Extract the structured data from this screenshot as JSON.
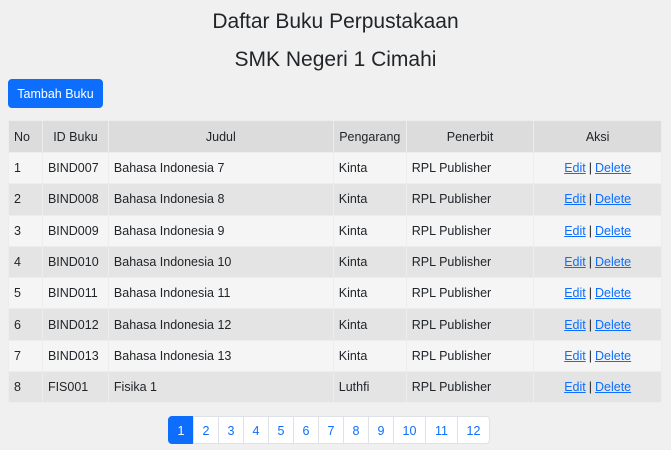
{
  "header": {
    "title": "Daftar Buku Perpustakaan",
    "subtitle": "SMK Negeri 1 Cimahi"
  },
  "toolbar": {
    "add_label": "Tambah Buku"
  },
  "table": {
    "columns": [
      "No",
      "ID Buku",
      "Judul",
      "Pengarang",
      "Penerbit",
      "Aksi"
    ],
    "rows": [
      {
        "no": "1",
        "id": "BIND007",
        "judul": "Bahasa Indonesia 7",
        "pengarang": "Kinta",
        "penerbit": "RPL Publisher"
      },
      {
        "no": "2",
        "id": "BIND008",
        "judul": "Bahasa Indonesia 8",
        "pengarang": "Kinta",
        "penerbit": "RPL Publisher"
      },
      {
        "no": "3",
        "id": "BIND009",
        "judul": "Bahasa Indonesia 9",
        "pengarang": "Kinta",
        "penerbit": "RPL Publisher"
      },
      {
        "no": "4",
        "id": "BIND010",
        "judul": "Bahasa Indonesia 10",
        "pengarang": "Kinta",
        "penerbit": "RPL Publisher"
      },
      {
        "no": "5",
        "id": "BIND011",
        "judul": "Bahasa Indonesia 11",
        "pengarang": "Kinta",
        "penerbit": "RPL Publisher"
      },
      {
        "no": "6",
        "id": "BIND012",
        "judul": "Bahasa Indonesia 12",
        "pengarang": "Kinta",
        "penerbit": "RPL Publisher"
      },
      {
        "no": "7",
        "id": "BIND013",
        "judul": "Bahasa Indonesia 13",
        "pengarang": "Kinta",
        "penerbit": "RPL Publisher"
      },
      {
        "no": "8",
        "id": "FIS001",
        "judul": "Fisika 1",
        "pengarang": "Luthfi",
        "penerbit": "RPL Publisher"
      }
    ],
    "actions": {
      "edit": "Edit",
      "separator": "|",
      "delete": "Delete"
    }
  },
  "pagination": {
    "pages": [
      "1",
      "2",
      "3",
      "4",
      "5",
      "6",
      "7",
      "8",
      "9",
      "10",
      "11",
      "12"
    ],
    "active": "1"
  },
  "colors": {
    "accent": "#0d6efd",
    "background": "#f0f0f0",
    "header_row": "#dcdcdc"
  }
}
